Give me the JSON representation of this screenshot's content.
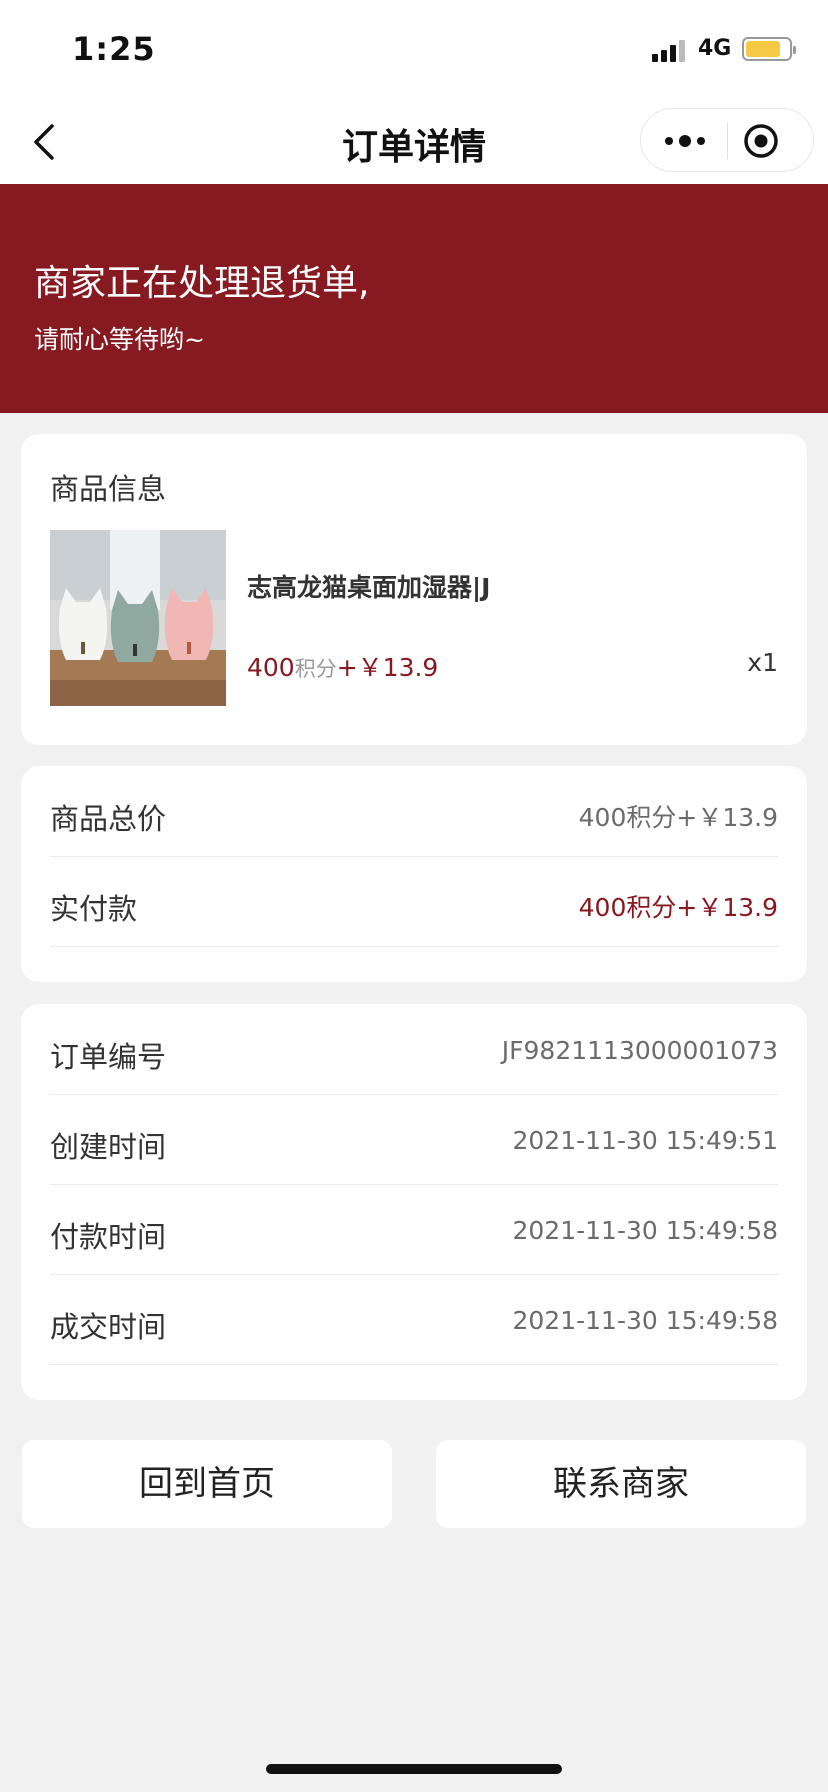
{
  "status_bar": {
    "time": "1:25",
    "network": "4G"
  },
  "nav": {
    "title": "订单详情",
    "back_icon": "chevron-left-icon",
    "more_icon": "more-dots-icon",
    "close_icon": "target-circle-icon"
  },
  "banner": {
    "main": "商家正在处理退货单,",
    "sub": "请耐心等待哟~",
    "bg_color": "#861a20"
  },
  "product": {
    "section_title": "商品信息",
    "name": "志高龙猫桌面加湿器|J",
    "price_points": "400",
    "price_points_unit": "积分",
    "price_cash": "+￥13.9",
    "quantity": "x1",
    "image_icon": "product-photo-humidifiers"
  },
  "pricing": {
    "rows": [
      {
        "label": "商品总价",
        "value": "400积分+￥13.9"
      },
      {
        "label": "实付款",
        "value": "400积分+￥13.9"
      }
    ]
  },
  "order_info": {
    "rows": [
      {
        "label": "订单编号",
        "value": "JF9821113000001073"
      },
      {
        "label": "创建时间",
        "value": "2021-11-30 15:49:51"
      },
      {
        "label": "付款时间",
        "value": "2021-11-30 15:49:58"
      },
      {
        "label": "成交时间",
        "value": "2021-11-30 15:49:58"
      }
    ]
  },
  "buttons": {
    "home": "回到首页",
    "contact": "联系商家"
  }
}
